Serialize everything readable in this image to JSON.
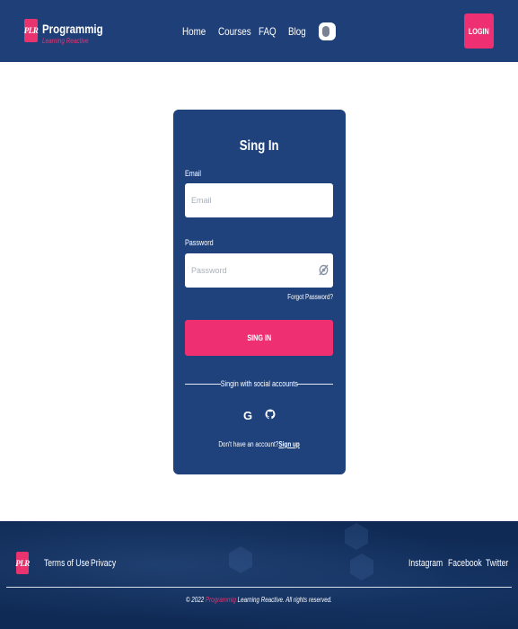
{
  "header": {
    "logo_text": "PLR",
    "brand_name": "Programmig",
    "tagline": "Learning Reactive",
    "nav": [
      "Home",
      "Courses",
      "FAQ",
      "Blog"
    ],
    "theme_toggle_icon": "toggle-icon",
    "login_label": "LOGIN"
  },
  "form": {
    "title": "Sing In",
    "email_label": "Email",
    "email_placeholder": "Email",
    "email_value": "",
    "password_label": "Password",
    "password_placeholder": "Password",
    "password_value": "",
    "password_icon": "eye-slash-icon",
    "forgot_label": "Forgot Password?",
    "submit_label": "SING IN",
    "social_label": "Singin with social accounts",
    "social_icons": [
      "google-icon",
      "github-icon"
    ],
    "google_glyph": "G",
    "no_account_text": "Don't have an account?",
    "signup_label": "Sign up"
  },
  "footer": {
    "logo_text": "PLR",
    "links_left": [
      "Terms of Use",
      "Privacy"
    ],
    "links_right": [
      "Instagram",
      "Facebook",
      "Twitter"
    ],
    "copyright_prefix": "© 2022",
    "copyright_brand": "Programmig",
    "copyright_suffix": "Learning Reactive. All rights reserved."
  },
  "colors": {
    "primary_blue": "#1f3f78",
    "card_blue": "#1f427c",
    "accent_pink": "#ee2f72",
    "footer_navy": "#0f2a55"
  }
}
